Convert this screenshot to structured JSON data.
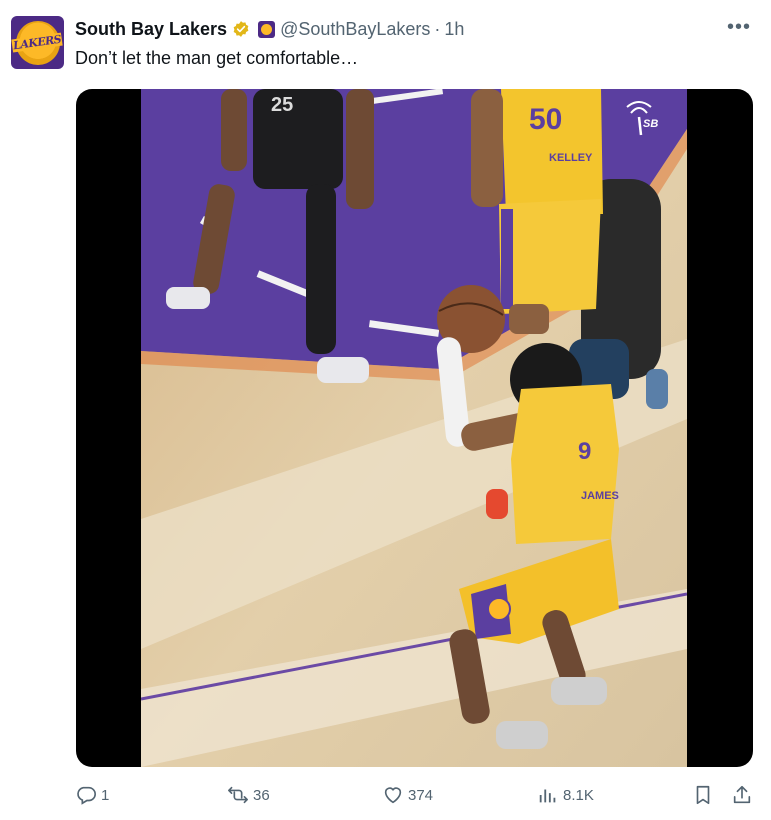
{
  "tweet": {
    "display_name": "South Bay Lakers",
    "handle": "@SouthBayLakers",
    "separator": "·",
    "time": "1h",
    "more_label": "•••",
    "text": "Don’t let the man get comfortable…",
    "avatar_text": "LAKERS"
  },
  "media": {
    "watermark": "SB",
    "jersey_top": "50",
    "jersey_top_name": "KELLEY",
    "jersey_main": "9",
    "jersey_main_name": "JAMES",
    "jersey_opponent": "25"
  },
  "actions": {
    "replies": "1",
    "reposts": "36",
    "likes": "374",
    "views": "8.1K"
  },
  "icons": [
    "verified-badge-icon",
    "affiliate-badge-icon",
    "more-icon",
    "reply-icon",
    "repost-icon",
    "like-icon",
    "views-icon",
    "bookmark-icon",
    "share-icon"
  ],
  "colors": {
    "lakers_purple": "#4c2a85",
    "lakers_gold": "#fdb927",
    "verified_gold": "#e2b719",
    "muted_text": "#536471"
  }
}
